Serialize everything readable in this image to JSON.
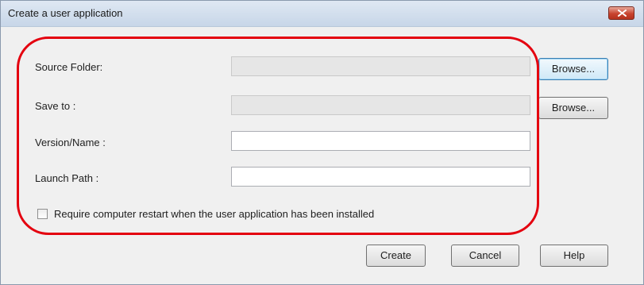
{
  "window": {
    "title": "Create a user application"
  },
  "form": {
    "source_folder": {
      "label": "Source Folder:",
      "value": "",
      "browse_label": "Browse..."
    },
    "save_to": {
      "label": "Save to :",
      "value": "",
      "browse_label": "Browse..."
    },
    "version_name": {
      "label": "Version/Name :",
      "value": ""
    },
    "launch_path": {
      "label": "Launch Path :",
      "value": ""
    },
    "restart_checkbox": {
      "label": "Require computer restart when the user application has been installed",
      "checked": false
    }
  },
  "actions": {
    "create_label": "Create",
    "cancel_label": "Cancel",
    "help_label": "Help"
  },
  "icons": {
    "close": "close-icon"
  },
  "colors": {
    "highlight": "#e4000f",
    "close_button": "#c8442f"
  }
}
